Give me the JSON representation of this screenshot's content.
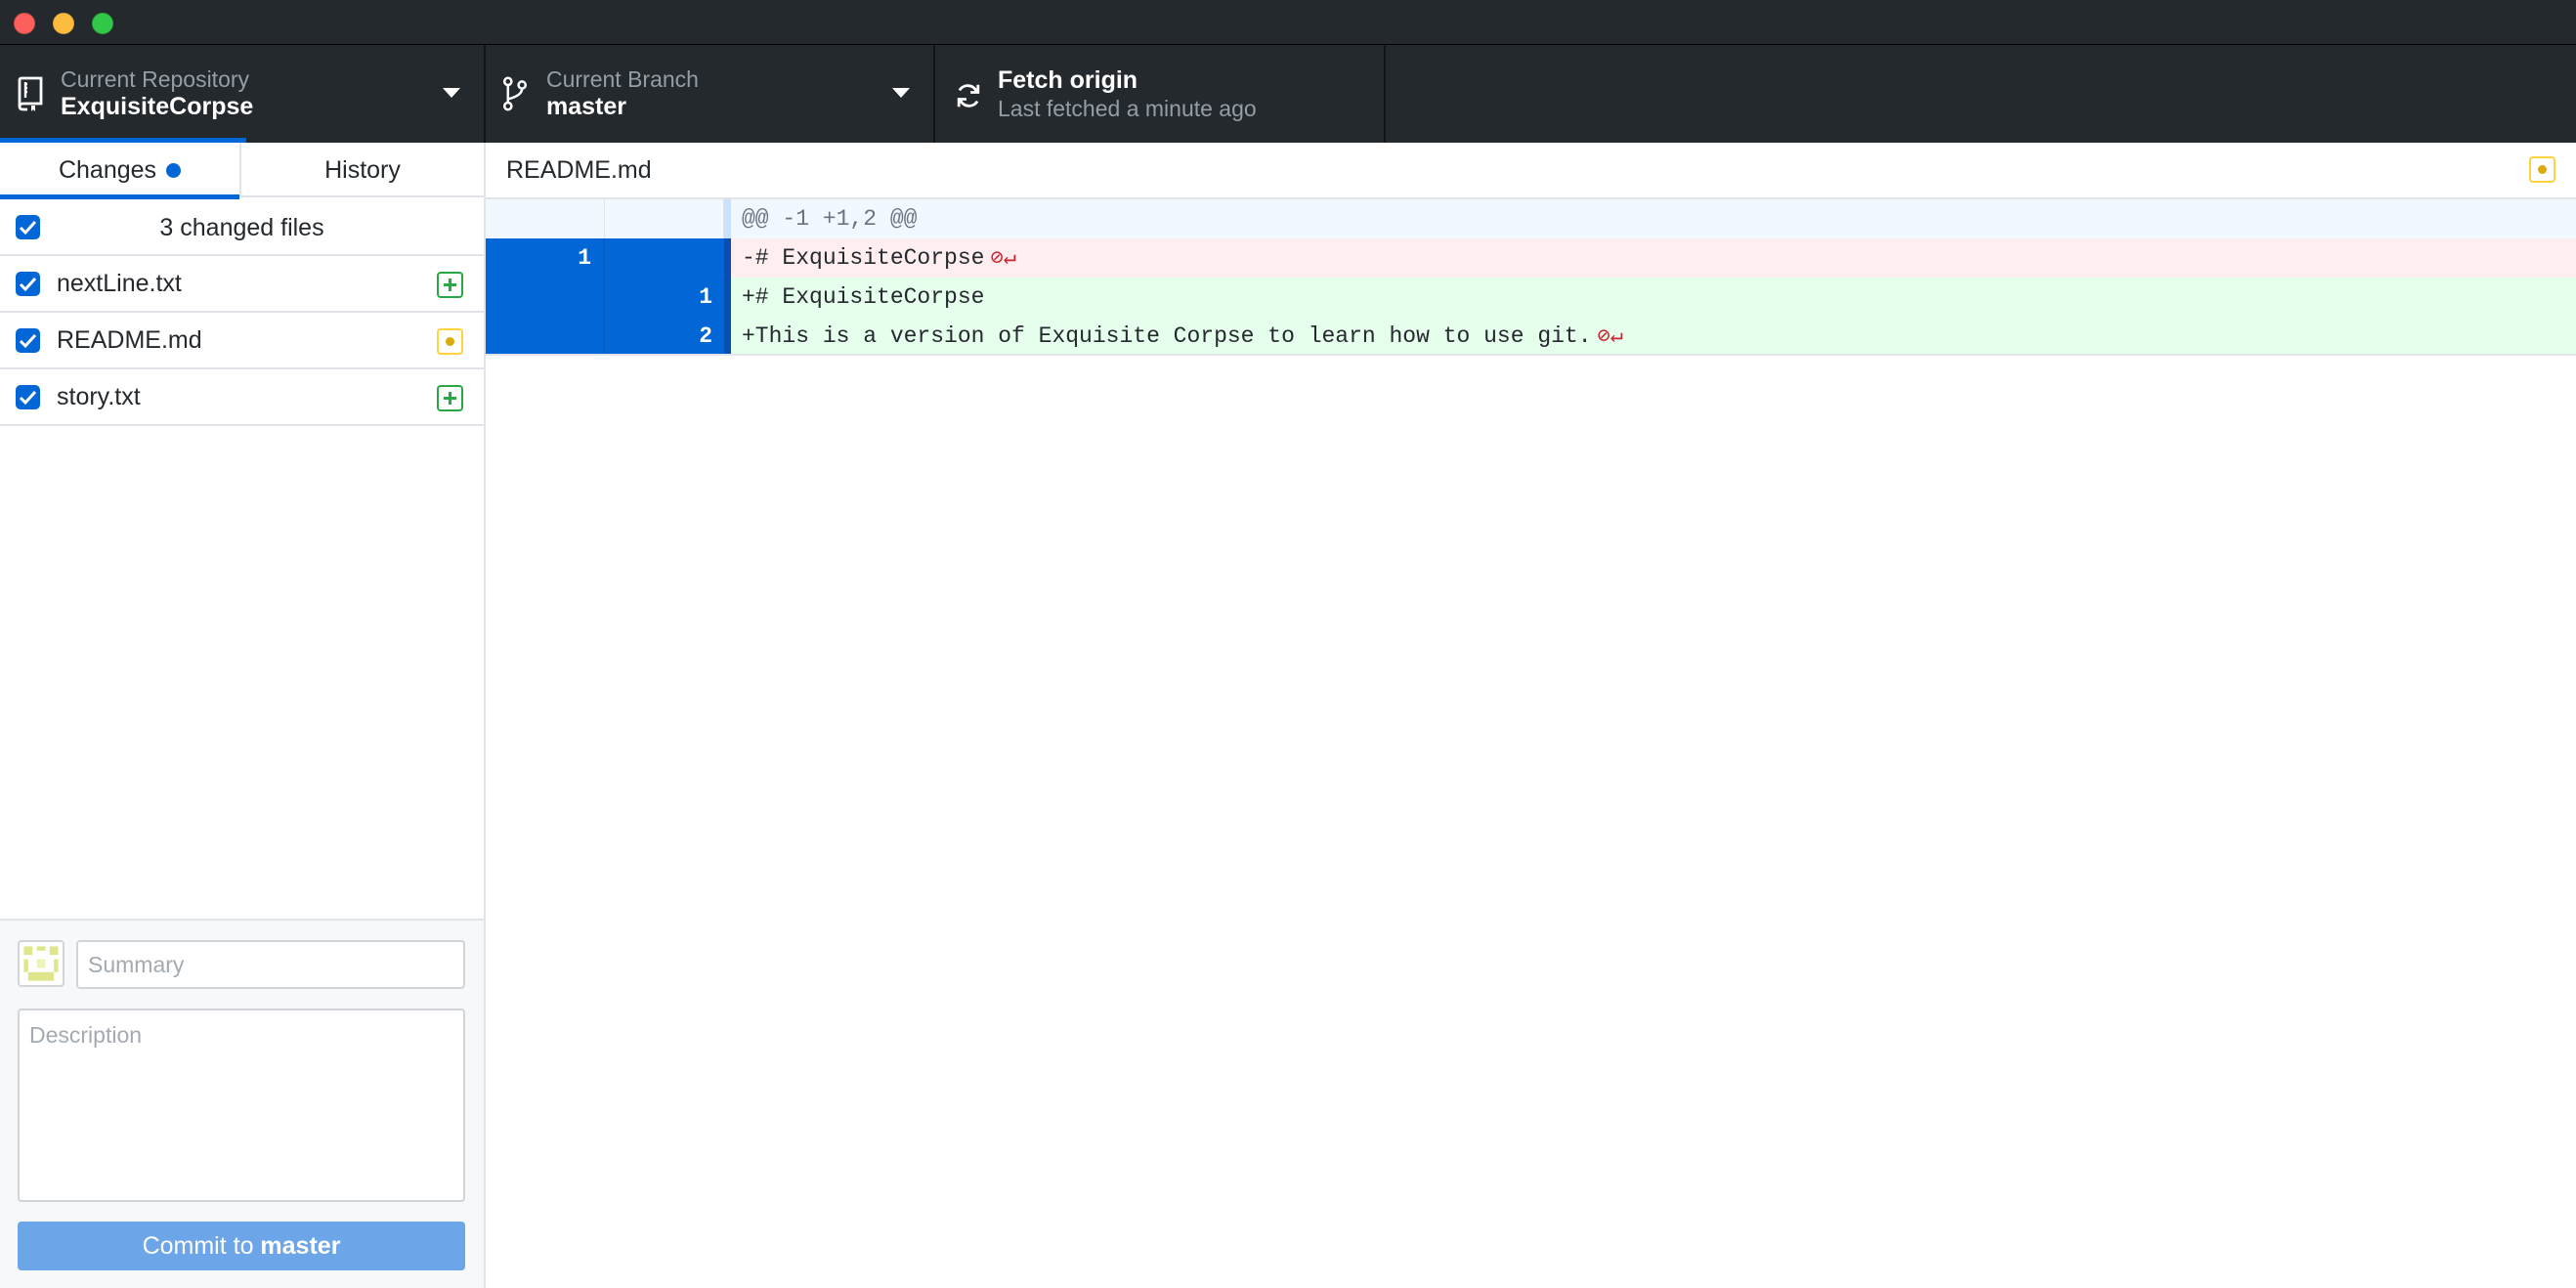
{
  "toolbar": {
    "repository": {
      "label": "Current Repository",
      "value": "ExquisiteCorpse"
    },
    "branch": {
      "label": "Current Branch",
      "value": "master"
    },
    "fetch": {
      "title": "Fetch origin",
      "subtitle": "Last fetched a minute ago"
    }
  },
  "sidebar": {
    "tabs": [
      {
        "label": "Changes"
      },
      {
        "label": "History"
      }
    ],
    "changed_files_label": "3 changed files",
    "files": [
      {
        "name": "nextLine.txt",
        "status": "added"
      },
      {
        "name": "README.md",
        "status": "modified"
      },
      {
        "name": "story.txt",
        "status": "added"
      }
    ],
    "commit": {
      "summary_placeholder": "Summary",
      "description_placeholder": "Description",
      "button_prefix": "Commit to ",
      "button_branch": "master"
    }
  },
  "diff": {
    "file": "README.md",
    "hunk_header": "@@ -1 +1,2 @@",
    "lines": [
      {
        "old": "1",
        "new": "",
        "text": "-# ExquisiteCorpse",
        "type": "deleted"
      },
      {
        "old": "",
        "new": "1",
        "text": "+# ExquisiteCorpse",
        "type": "added"
      },
      {
        "old": "",
        "new": "2",
        "text": "+This is a version of Exquisite Corpse to learn how to use git.",
        "type": "added"
      }
    ],
    "no_newline_marker": "⊘↵"
  },
  "colors": {
    "accent": "#0366d6",
    "added": "#28a745",
    "modified": "#dbab09",
    "toolbar_bg": "#24292e"
  }
}
